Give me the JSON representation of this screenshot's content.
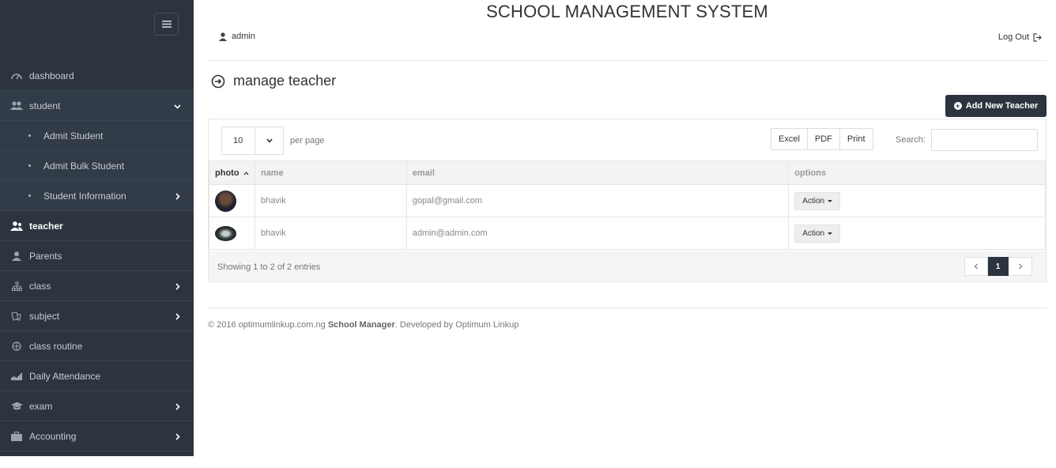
{
  "app": {
    "title": "SCHOOL MANAGEMENT SYSTEM"
  },
  "header": {
    "user": "admin",
    "logout": "Log Out"
  },
  "sidebar": {
    "items": [
      {
        "label": "dashboard",
        "icon": "dashboard-icon"
      },
      {
        "label": "student",
        "icon": "users-icon",
        "expanded": true,
        "children": [
          {
            "label": "Admit Student"
          },
          {
            "label": "Admit Bulk Student"
          },
          {
            "label": "Student Information",
            "has_children": true
          }
        ]
      },
      {
        "label": "teacher",
        "icon": "teacher-icon",
        "active": true
      },
      {
        "label": "Parents",
        "icon": "user-icon"
      },
      {
        "label": "class",
        "icon": "sitemap-icon",
        "has_children": true
      },
      {
        "label": "subject",
        "icon": "book-icon",
        "has_children": true
      },
      {
        "label": "class routine",
        "icon": "clock-icon"
      },
      {
        "label": "Daily Attendance",
        "icon": "chart-icon"
      },
      {
        "label": "exam",
        "icon": "graduation-cap-icon",
        "has_children": true
      },
      {
        "label": "Accounting",
        "icon": "briefcase-icon",
        "has_children": true
      }
    ]
  },
  "page": {
    "heading": "manage teacher",
    "add_button": "Add New Teacher"
  },
  "table": {
    "per_page_value": "10",
    "per_page_label": "per page",
    "export_buttons": [
      "Excel",
      "PDF",
      "Print"
    ],
    "search_label": "Search:",
    "columns": [
      "photo",
      "name",
      "email",
      "options"
    ],
    "rows": [
      {
        "name": "bhavik",
        "email": "gopal@gmail.com",
        "action": "Action"
      },
      {
        "name": "bhavik",
        "email": "admin@admin.com",
        "action": "Action"
      }
    ],
    "info": "Showing 1 to 2 of 2 entries",
    "current_page": "1"
  },
  "footer": {
    "prefix": "© 2016 optimumlinkup.com.ng",
    "brand": "School Manager",
    "suffix": ". Developed by Optimum Linkup"
  },
  "colors": {
    "sidebar": "#2c3440",
    "accent": "#2c3440"
  }
}
